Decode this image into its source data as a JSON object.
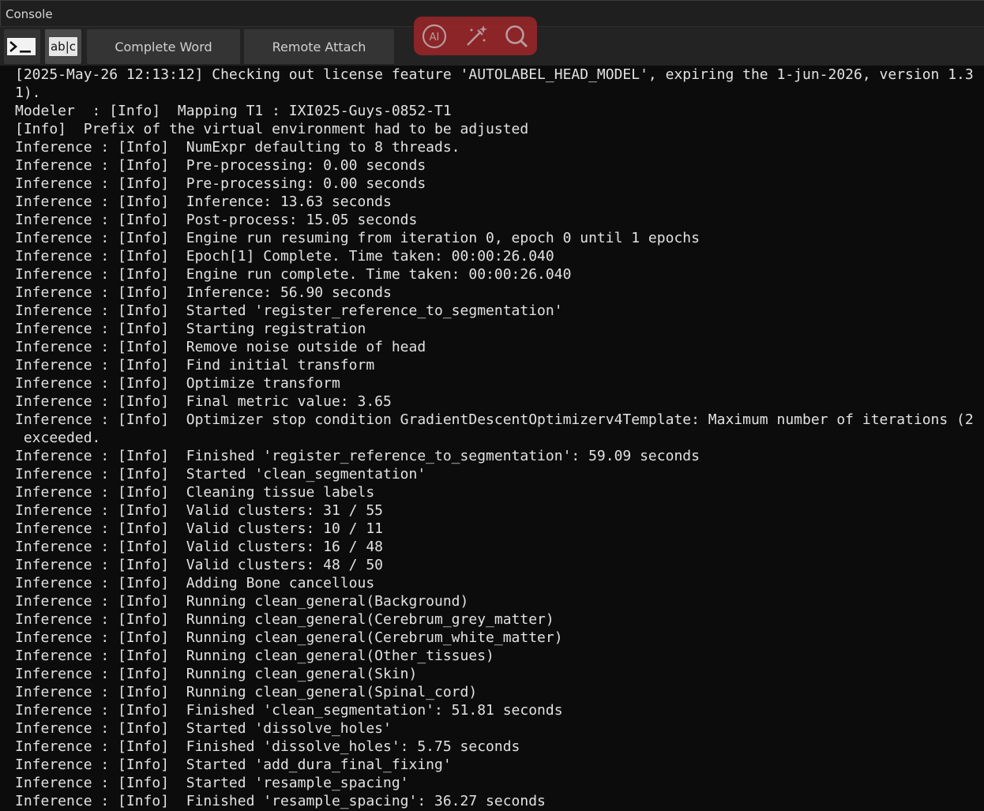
{
  "window": {
    "title": "Console"
  },
  "toolbar": {
    "terminal_icon": "terminal-icon",
    "abc_icon_label": "ab|c",
    "complete_word_label": "Complete Word",
    "remote_attach_label": "Remote Attach"
  },
  "floating_toolbar": {
    "icons": [
      "ai-icon",
      "magic-wand-icon",
      "search-icon"
    ],
    "ai_label": "AI",
    "color": "#b3262b"
  },
  "console": {
    "lines": [
      "[2025-May-26 12:13:12] Checking out license feature 'AUTOLABEL_HEAD_MODEL', expiring the 1-jun-2026, version 1.3",
      "1).",
      "Modeler  : [Info]  Mapping T1 : IXI025-Guys-0852-T1",
      "[Info]  Prefix of the virtual environment had to be adjusted",
      "Inference : [Info]  NumExpr defaulting to 8 threads.",
      "Inference : [Info]  Pre-processing: 0.00 seconds",
      "Inference : [Info]  Pre-processing: 0.00 seconds",
      "Inference : [Info]  Inference: 13.63 seconds",
      "Inference : [Info]  Post-process: 15.05 seconds",
      "Inference : [Info]  Engine run resuming from iteration 0, epoch 0 until 1 epochs",
      "Inference : [Info]  Epoch[1] Complete. Time taken: 00:00:26.040",
      "Inference : [Info]  Engine run complete. Time taken: 00:00:26.040",
      "Inference : [Info]  Inference: 56.90 seconds",
      "Inference : [Info]  Started 'register_reference_to_segmentation'",
      "Inference : [Info]  Starting registration",
      "Inference : [Info]  Remove noise outside of head",
      "Inference : [Info]  Find initial transform",
      "Inference : [Info]  Optimize transform",
      "Inference : [Info]  Final metric value: 3.65",
      "Inference : [Info]  Optimizer stop condition GradientDescentOptimizerv4Template: Maximum number of iterations (2",
      " exceeded.",
      "Inference : [Info]  Finished 'register_reference_to_segmentation': 59.09 seconds",
      "Inference : [Info]  Started 'clean_segmentation'",
      "Inference : [Info]  Cleaning tissue labels",
      "Inference : [Info]  Valid clusters: 31 / 55",
      "Inference : [Info]  Valid clusters: 10 / 11",
      "Inference : [Info]  Valid clusters: 16 / 48",
      "Inference : [Info]  Valid clusters: 48 / 50",
      "Inference : [Info]  Adding Bone cancellous",
      "Inference : [Info]  Running clean_general(Background)",
      "Inference : [Info]  Running clean_general(Cerebrum_grey_matter)",
      "Inference : [Info]  Running clean_general(Cerebrum_white_matter)",
      "Inference : [Info]  Running clean_general(Other_tissues)",
      "Inference : [Info]  Running clean_general(Skin)",
      "Inference : [Info]  Running clean_general(Spinal_cord)",
      "Inference : [Info]  Finished 'clean_segmentation': 51.81 seconds",
      "Inference : [Info]  Started 'dissolve_holes'",
      "Inference : [Info]  Finished 'dissolve_holes': 5.75 seconds",
      "Inference : [Info]  Started 'add_dura_final_fixing'",
      "Inference : [Info]  Started 'resample_spacing'",
      "Inference : [Info]  Finished 'resample_spacing': 36.27 seconds"
    ]
  }
}
